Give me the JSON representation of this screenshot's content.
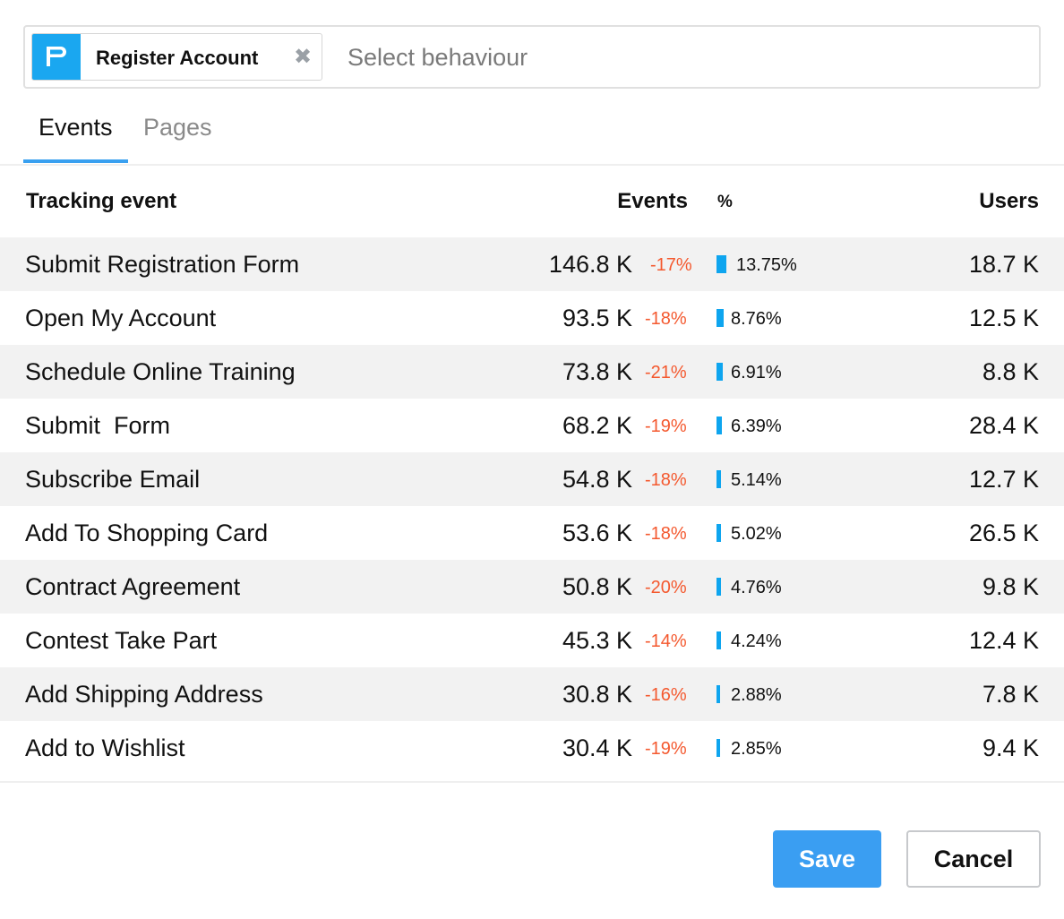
{
  "selector": {
    "chip": {
      "label": "Register Account",
      "icon": "flag-icon",
      "close_icon": "close-icon"
    },
    "placeholder": "Select behaviour",
    "value": ""
  },
  "tabs": [
    {
      "label": "Events",
      "active": true
    },
    {
      "label": "Pages",
      "active": false
    }
  ],
  "table": {
    "headers": {
      "event": "Tracking event",
      "events": "Events",
      "percent": "%",
      "users": "Users"
    },
    "rows": [
      {
        "name": "Submit Registration Form",
        "events": "146.8 K",
        "change": "-17%",
        "percent": "13.75%",
        "percent_value": 13.75,
        "users": "18.7 K"
      },
      {
        "name": "Open My Account",
        "events": "93.5 K",
        "change": "-18%",
        "percent": "8.76%",
        "percent_value": 8.76,
        "users": "12.5 K"
      },
      {
        "name": "Schedule Online Training",
        "events": "73.8 K",
        "change": "-21%",
        "percent": "6.91%",
        "percent_value": 6.91,
        "users": "8.8 K"
      },
      {
        "name": "Submit  Form",
        "events": "68.2 K",
        "change": "-19%",
        "percent": "6.39%",
        "percent_value": 6.39,
        "users": "28.4 K"
      },
      {
        "name": "Subscribe Email",
        "events": "54.8 K",
        "change": "-18%",
        "percent": "5.14%",
        "percent_value": 5.14,
        "users": "12.7 K"
      },
      {
        "name": "Add To Shopping Card",
        "events": "53.6 K",
        "change": "-18%",
        "percent": "5.02%",
        "percent_value": 5.02,
        "users": "26.5 K"
      },
      {
        "name": "Contract Agreement",
        "events": "50.8 K",
        "change": "-20%",
        "percent": "4.76%",
        "percent_value": 4.76,
        "users": "9.8 K"
      },
      {
        "name": "Contest Take Part",
        "events": "45.3 K",
        "change": "-14%",
        "percent": "4.24%",
        "percent_value": 4.24,
        "users": "12.4 K"
      },
      {
        "name": "Add Shipping Address",
        "events": "30.8 K",
        "change": "-16%",
        "percent": "2.88%",
        "percent_value": 2.88,
        "users": "7.8 K"
      },
      {
        "name": "Add to Wishlist",
        "events": "30.4 K",
        "change": "-19%",
        "percent": "2.85%",
        "percent_value": 2.85,
        "users": "9.4 K"
      }
    ]
  },
  "buttons": {
    "save": "Save",
    "cancel": "Cancel"
  },
  "colors": {
    "accent": "#39a0f0",
    "chip_icon_bg": "#1aa7f0",
    "bar": "#0ea5ef",
    "negative_change": "#f4592f",
    "row_alt": "#f2f2f2"
  }
}
